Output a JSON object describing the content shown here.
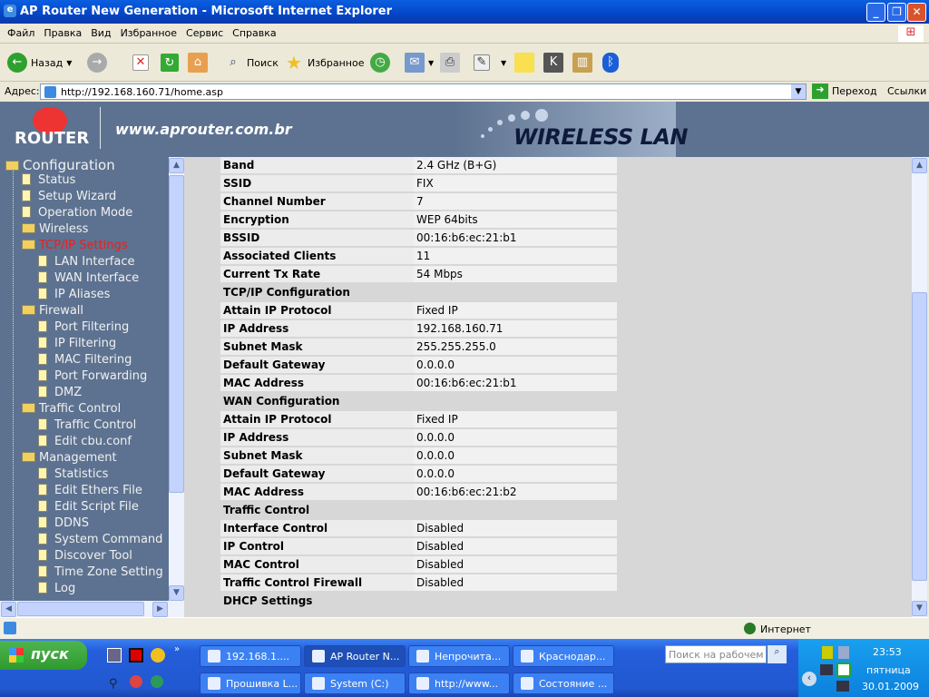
{
  "window": {
    "title": "AP Router New Generation - Microsoft Internet Explorer"
  },
  "menu": [
    "Файл",
    "Правка",
    "Вид",
    "Избранное",
    "Сервис",
    "Справка"
  ],
  "toolbar": {
    "back": "Назад",
    "search": "Поиск",
    "favorites": "Избранное"
  },
  "address": {
    "label": "Адрес:",
    "url": "http://192.168.160.71/home.asp",
    "go": "Переход",
    "links": "Ссылки"
  },
  "banner": {
    "logo": "ROUTER",
    "site": "www.aprouter.com.br",
    "tagline": "WIRELESS LAN"
  },
  "tree": {
    "root": "Configuration",
    "items": [
      {
        "label": "Status",
        "level": 1,
        "type": "doc"
      },
      {
        "label": "Setup Wizard",
        "level": 1,
        "type": "doc"
      },
      {
        "label": "Operation Mode",
        "level": 1,
        "type": "doc"
      },
      {
        "label": "Wireless",
        "level": 1,
        "type": "folder"
      },
      {
        "label": "TCP/IP Settings",
        "level": 1,
        "type": "folder",
        "active": true
      },
      {
        "label": "LAN Interface",
        "level": 2,
        "type": "doc"
      },
      {
        "label": "WAN Interface",
        "level": 2,
        "type": "doc"
      },
      {
        "label": "IP Aliases",
        "level": 2,
        "type": "doc"
      },
      {
        "label": "Firewall",
        "level": 1,
        "type": "folder"
      },
      {
        "label": "Port Filtering",
        "level": 2,
        "type": "doc"
      },
      {
        "label": "IP Filtering",
        "level": 2,
        "type": "doc"
      },
      {
        "label": "MAC Filtering",
        "level": 2,
        "type": "doc"
      },
      {
        "label": "Port Forwarding",
        "level": 2,
        "type": "doc"
      },
      {
        "label": "DMZ",
        "level": 2,
        "type": "doc"
      },
      {
        "label": "Traffic Control",
        "level": 1,
        "type": "folder"
      },
      {
        "label": "Traffic Control",
        "level": 2,
        "type": "doc"
      },
      {
        "label": "Edit cbu.conf",
        "level": 2,
        "type": "doc"
      },
      {
        "label": "Management",
        "level": 1,
        "type": "folder"
      },
      {
        "label": "Statistics",
        "level": 2,
        "type": "doc"
      },
      {
        "label": "Edit Ethers File",
        "level": 2,
        "type": "doc"
      },
      {
        "label": "Edit Script File",
        "level": 2,
        "type": "doc"
      },
      {
        "label": "DDNS",
        "level": 2,
        "type": "doc"
      },
      {
        "label": "System Command",
        "level": 2,
        "type": "doc"
      },
      {
        "label": "Discover Tool",
        "level": 2,
        "type": "doc"
      },
      {
        "label": "Time Zone Setting",
        "level": 2,
        "type": "doc"
      },
      {
        "label": "Log",
        "level": 2,
        "type": "doc"
      }
    ]
  },
  "status_rows": [
    {
      "label": "Band",
      "value": "2.4 GHz (B+G)"
    },
    {
      "label": "SSID",
      "value": "FIX"
    },
    {
      "label": "Channel Number",
      "value": "7"
    },
    {
      "label": "Encryption",
      "value": "WEP 64bits"
    },
    {
      "label": "BSSID",
      "value": "00:16:b6:ec:21:b1"
    },
    {
      "label": "Associated Clients",
      "value": "11"
    },
    {
      "label": "Current Tx Rate",
      "value": "54 Mbps"
    },
    {
      "section": "TCP/IP Configuration"
    },
    {
      "label": "Attain IP Protocol",
      "value": "Fixed IP"
    },
    {
      "label": "IP Address",
      "value": "192.168.160.71"
    },
    {
      "label": "Subnet Mask",
      "value": "255.255.255.0"
    },
    {
      "label": "Default Gateway",
      "value": "0.0.0.0"
    },
    {
      "label": "MAC Address",
      "value": "00:16:b6:ec:21:b1"
    },
    {
      "section": "WAN Configuration"
    },
    {
      "label": "Attain IP Protocol",
      "value": "Fixed IP"
    },
    {
      "label": "IP Address",
      "value": "0.0.0.0"
    },
    {
      "label": "Subnet Mask",
      "value": "0.0.0.0"
    },
    {
      "label": "Default Gateway",
      "value": "0.0.0.0"
    },
    {
      "label": "MAC Address",
      "value": "00:16:b6:ec:21:b2"
    },
    {
      "section": "Traffic Control"
    },
    {
      "label": "Interface Control",
      "value": "Disabled"
    },
    {
      "label": "IP Control",
      "value": "Disabled"
    },
    {
      "label": "MAC Control",
      "value": "Disabled"
    },
    {
      "label": "Traffic Control Firewall",
      "value": "Disabled"
    },
    {
      "section": "DHCP Settings"
    }
  ],
  "statusbar": {
    "zone": "Интернет"
  },
  "taskbar": {
    "start": "пуск",
    "tasks": [
      "192.168.1....",
      "AP Router N...",
      "Непрочита...",
      "Краснодар...",
      "Прошивка L...",
      "System (C:)",
      "http://www...",
      "Состояние ..."
    ],
    "active_task": 1,
    "search_placeholder": "Поиск на рабочем столе",
    "time": "23:53",
    "day": "пятница",
    "date": "30.01.2009"
  }
}
